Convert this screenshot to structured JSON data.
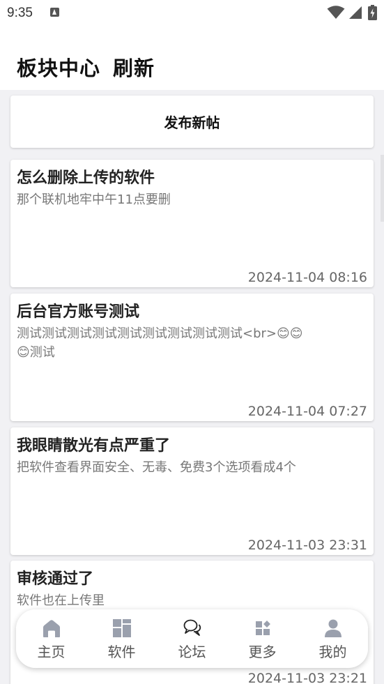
{
  "status_bar": {
    "time": "9:35"
  },
  "header": {
    "title": "板块中心",
    "refresh_label": "刷新"
  },
  "new_post": {
    "label": "发布新帖"
  },
  "posts": [
    {
      "title": "怎么删除上传的软件",
      "body": "那个联机地牢中午11点要删",
      "time": "2024-11-04 08:16"
    },
    {
      "title": "后台官方账号测试",
      "body_text": "测试测试测试测试测试测试测试测试测试<br>",
      "body_tail": "测试",
      "time": "2024-11-04 07:27"
    },
    {
      "title": "我眼睛散光有点严重了",
      "body": "把软件查看界面安全、无毒、免费3个选项看成4个",
      "time": "2024-11-03 23:31"
    },
    {
      "title": "审核通过了",
      "body": "软件也在上传里",
      "time": "2024-11-03 23:21"
    }
  ],
  "bottom_nav": {
    "items": [
      {
        "label": "主页",
        "icon": "home-icon"
      },
      {
        "label": "软件",
        "icon": "apps-grid-icon"
      },
      {
        "label": "论坛",
        "icon": "chat-bubbles-icon"
      },
      {
        "label": "更多",
        "icon": "more-widgets-icon"
      },
      {
        "label": "我的",
        "icon": "person-icon"
      }
    ]
  },
  "colors": {
    "accent_text": "#111111",
    "secondary_text": "#777777",
    "background": "#f1f1f4",
    "card": "#ffffff",
    "icon_gray": "#9aa0ad"
  }
}
